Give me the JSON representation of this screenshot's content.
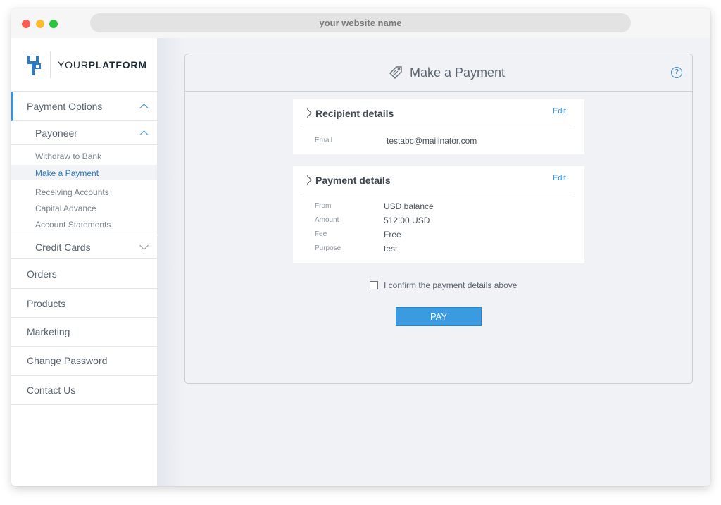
{
  "browser": {
    "url_placeholder": "your website name"
  },
  "logo": {
    "text_regular": "YOUR",
    "text_bold": "PLATFORM",
    "icon": "yp-logo-icon",
    "color": "#2d7bc4"
  },
  "sidebar": {
    "payment_options": "Payment Options",
    "payoneer": "Payoneer",
    "payoneer_items": [
      "Withdraw to Bank",
      "Make a Payment",
      "Receiving Accounts",
      "Capital Advance",
      "Account Statements"
    ],
    "credit_cards": "Credit Cards",
    "main_items": [
      "Orders",
      "Products",
      "Marketing",
      "Change Password",
      "Contact Us"
    ]
  },
  "main": {
    "title": "Make a Payment",
    "help_icon": "?",
    "recipient": {
      "title": "Recipient details",
      "edit": "Edit",
      "rows": [
        {
          "label": "Email",
          "value": "testabc@mailinator.com"
        }
      ]
    },
    "payment": {
      "title": "Payment details",
      "edit": "Edit",
      "rows": [
        {
          "label": "From",
          "value": "USD balance"
        },
        {
          "label": "Amount",
          "value": "512.00 USD"
        },
        {
          "label": "Fee",
          "value": "Free"
        },
        {
          "label": "Purpose",
          "value": "test"
        }
      ]
    },
    "confirm_label": "I confirm the payment details above",
    "pay_button": "PAY"
  },
  "colors": {
    "accent": "#3b8fd4",
    "button": "#3b9be0"
  }
}
